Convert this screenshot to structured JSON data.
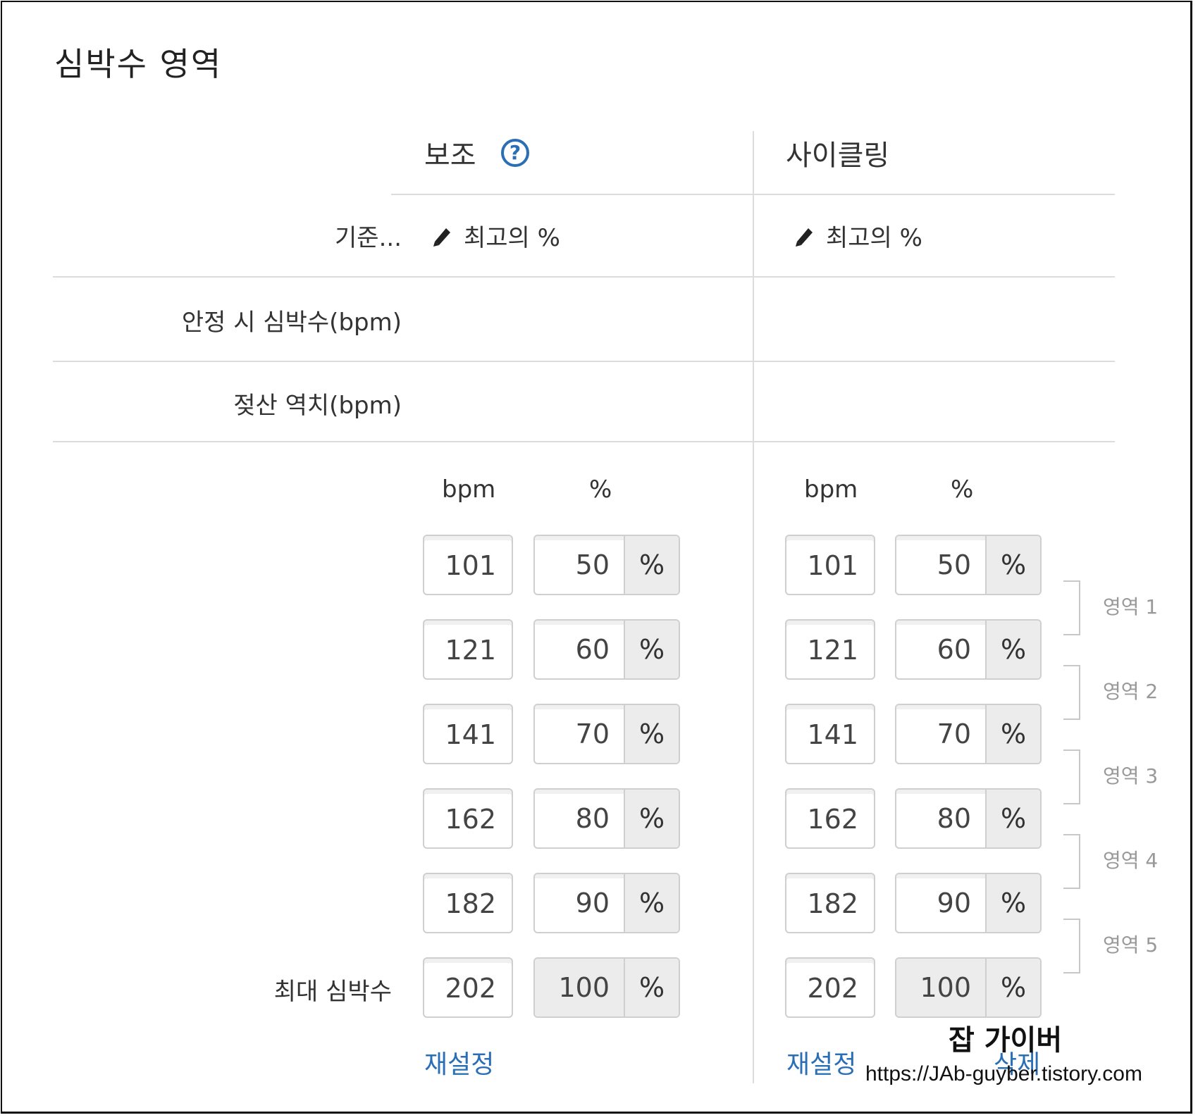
{
  "page_title": "심박수 영역",
  "columns": [
    {
      "name": "보조",
      "basis": "최고의 %",
      "reset": "재설정"
    },
    {
      "name": "사이클링",
      "basis": "최고의 %",
      "reset": "재설정",
      "delete": "삭제"
    }
  ],
  "help_icon": "?",
  "labels": {
    "basis": "기준...",
    "resting_hr": "안정 시 심박수(bpm)",
    "lactate_threshold": "젖산 역치(bpm)",
    "max_hr": "최대 심박수",
    "bpm_header": "bpm",
    "pct_header": "%",
    "pct_unit": "%"
  },
  "zones": {
    "bpm": [
      "101",
      "121",
      "141",
      "162",
      "182",
      "202"
    ],
    "pct": [
      "50",
      "60",
      "70",
      "80",
      "90",
      "100"
    ],
    "names": [
      "영역 1",
      "영역 2",
      "영역 3",
      "영역 4",
      "영역 5"
    ]
  },
  "watermark": {
    "title": "잡 가이버",
    "url": "https://JAb-guyber.tistory.com"
  },
  "colors": {
    "link": "#2a6fb6",
    "border": "#cfcfcf",
    "disabled_bg": "#ececec"
  }
}
